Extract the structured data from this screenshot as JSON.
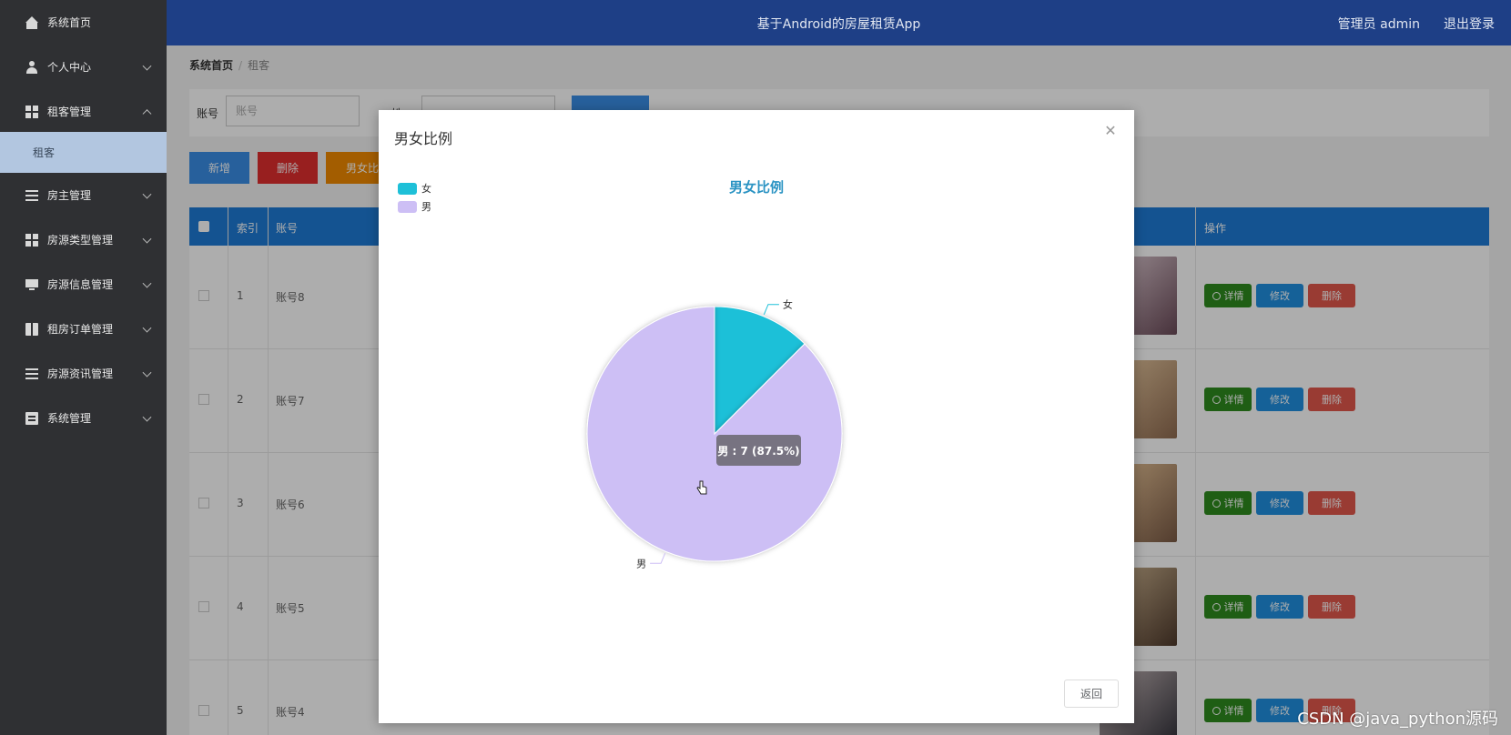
{
  "sidebar": {
    "items": [
      {
        "label": "系统首页",
        "icon": "home-icon",
        "expanded": null
      },
      {
        "label": "个人中心",
        "icon": "user-icon",
        "expanded": false
      },
      {
        "label": "租客管理",
        "icon": "grid-icon",
        "expanded": true
      },
      {
        "label": "房主管理",
        "icon": "list-icon",
        "expanded": false
      },
      {
        "label": "房源类型管理",
        "icon": "grid-icon",
        "expanded": false
      },
      {
        "label": "房源信息管理",
        "icon": "monitor-icon",
        "expanded": false
      },
      {
        "label": "租房订单管理",
        "icon": "book-icon",
        "expanded": false
      },
      {
        "label": "房源资讯管理",
        "icon": "list-icon",
        "expanded": false
      },
      {
        "label": "系统管理",
        "icon": "clipboard-icon",
        "expanded": false
      }
    ],
    "sub_item": "租客"
  },
  "header": {
    "title": "基于Android的房屋租赁App",
    "user": "管理员 admin",
    "logout": "退出登录"
  },
  "breadcrumb": {
    "home": "系统首页",
    "separator": "/",
    "current": "租客"
  },
  "filter": {
    "account_label": "账号",
    "account_placeholder": "账号",
    "name_label": "姓"
  },
  "buttons": {
    "add": "新增",
    "delete": "删除",
    "ratio": "男女比"
  },
  "table": {
    "headers": {
      "index": "索引",
      "account": "账号",
      "actions": "操作"
    },
    "rows": [
      {
        "index": "1",
        "account": "账号8"
      },
      {
        "index": "2",
        "account": "账号7"
      },
      {
        "index": "3",
        "account": "账号6"
      },
      {
        "index": "4",
        "account": "账号5"
      },
      {
        "index": "5",
        "account": "账号4"
      }
    ],
    "action_labels": {
      "detail": "详情",
      "edit": "修改",
      "delete": "删除"
    }
  },
  "modal": {
    "title": "男女比例",
    "return_label": "返回"
  },
  "chart_data": {
    "type": "pie",
    "title": "男女比例",
    "legend_position": "top-left",
    "slices": [
      {
        "name": "女",
        "value": 1,
        "color": "#1ec0d8"
      },
      {
        "name": "男",
        "value": 7,
        "color": "#cdbff5"
      }
    ],
    "tooltip": "男 : 7 (87.5%)"
  },
  "colors": {
    "header_bg": "#1e3f86",
    "sidebar_bg": "#2f3033",
    "primary": "#3a8ee6",
    "danger": "#e02f2f",
    "warning": "#f08a00",
    "success": "#2e8b1e",
    "chart_title": "#2a93c3"
  },
  "watermark": "CSDN @java_python源码"
}
